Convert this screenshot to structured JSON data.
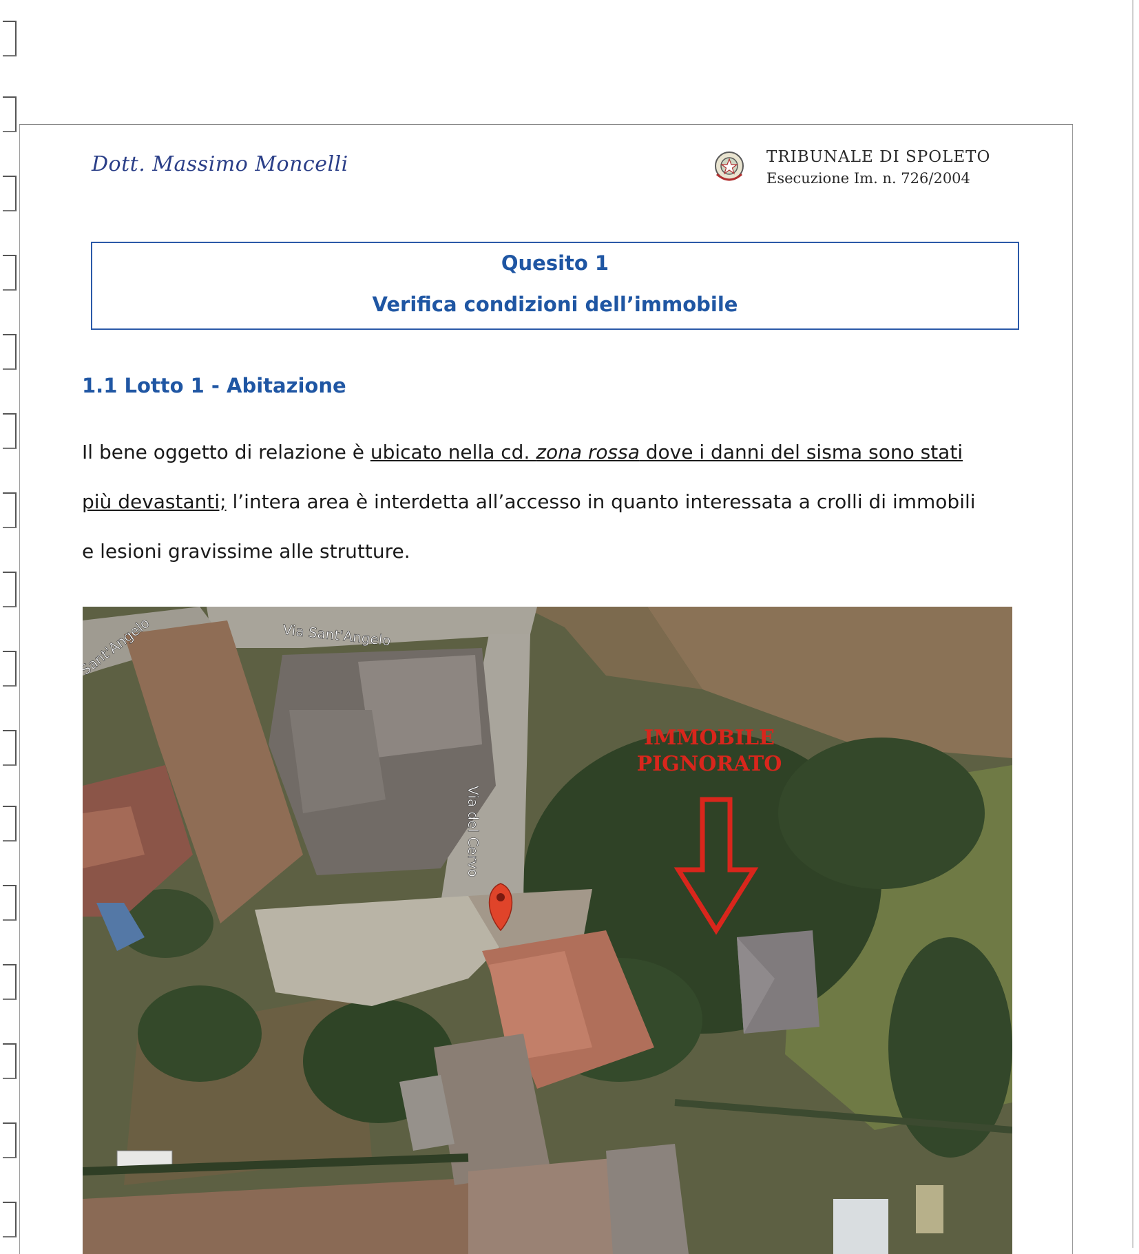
{
  "header": {
    "author": "Dott. Massimo Moncelli",
    "court": "TRIBUNALE DI SPOLETO",
    "execution": "Esecuzione Im. n. 726/2004"
  },
  "title_box": {
    "line1": "Quesito 1",
    "line2": "Verifica condizioni dell’immobile"
  },
  "section": {
    "heading": "1.1 Lotto 1 - Abitazione"
  },
  "paragraph": {
    "l1_a": "Il bene oggetto di relazione è ",
    "l1_u1": "ubicato nella cd. ",
    "l1_ui": "zona rossa",
    "l1_u2": " dove i danni del sisma sono stati",
    "l2_u": "più devastanti;",
    "l2_b": " l’intera area è interdetta all’accesso in quanto interessata a crolli di immobili",
    "l3": "e lesioni gravissime alle strutture."
  },
  "map": {
    "street_1": "Via Sant'Angelo",
    "street_2": "Sant'Angelo",
    "street_3": "Via del Cervo",
    "annotation_line1": "IMMOBILE",
    "annotation_line2": "PIGNORATO",
    "marker_icon": "map-pin-icon",
    "arrow_icon": "down-arrow-icon",
    "annotation_color": "#d9261c"
  },
  "colors": {
    "heading_blue": "#1f56a3",
    "box_border": "#2b59a8",
    "author_blue": "#2b3f88"
  }
}
